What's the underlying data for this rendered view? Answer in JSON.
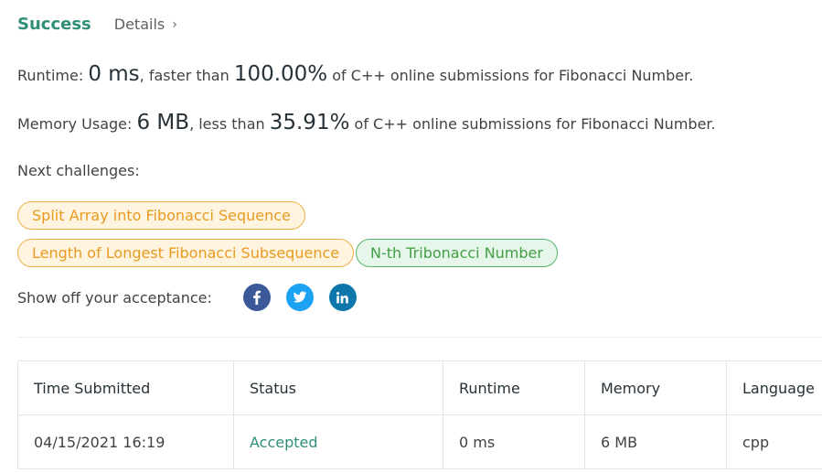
{
  "result": {
    "status_label": "Success",
    "details_label": "Details",
    "details_chevron": "›"
  },
  "runtime": {
    "label": "Runtime: ",
    "value": "0 ms",
    "middle": ", faster than ",
    "percent": "100.00%",
    "suffix": " of C++ online submissions for Fibonacci Number."
  },
  "memory": {
    "label": "Memory Usage: ",
    "value": "6 MB",
    "middle": ", less than ",
    "percent": "35.91%",
    "suffix": " of C++ online submissions for Fibonacci Number."
  },
  "next_challenges": {
    "label": "Next challenges:",
    "items": [
      {
        "title": "Split Array into Fibonacci Sequence",
        "difficulty": "medium"
      },
      {
        "title": "Length of Longest Fibonacci Subsequence",
        "difficulty": "medium"
      },
      {
        "title": "N-th Tribonacci Number",
        "difficulty": "easy"
      }
    ]
  },
  "share": {
    "label": "Show off your acceptance:",
    "icons": [
      "facebook-icon",
      "twitter-icon",
      "linkedin-icon"
    ]
  },
  "colors": {
    "success_green": "#2f8f79",
    "medium_orange": "#e89b20",
    "easy_green": "#43a047",
    "facebook": "#3b5998",
    "twitter": "#1da1f2",
    "linkedin": "#0e76a8"
  },
  "submissions_table": {
    "headers": [
      "Time Submitted",
      "Status",
      "Runtime",
      "Memory",
      "Language"
    ],
    "rows": [
      [
        "04/15/2021 16:19",
        "Accepted",
        "0 ms",
        "6 MB",
        "cpp"
      ]
    ]
  }
}
